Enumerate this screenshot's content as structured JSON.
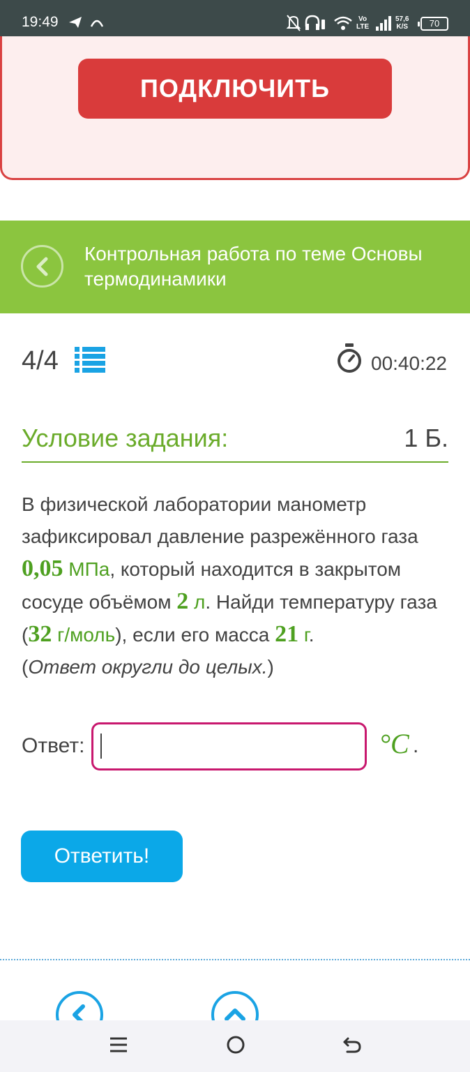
{
  "status_bar": {
    "time": "19:49",
    "network_top": "Vo",
    "network_bottom": "LTE",
    "speed_top": "57,6",
    "speed_bottom": "K/S",
    "battery": "70"
  },
  "ad": {
    "button_label": "ПОДКЛЮЧИТЬ"
  },
  "header": {
    "title": "Контрольная работа по теме Основы термодинамики"
  },
  "progress": {
    "current": "4",
    "separator": "/",
    "total": "4",
    "timer": "00:40:22"
  },
  "task": {
    "heading": "Условие задания:",
    "points": "1 Б.",
    "text_1": "В физической лаборатории манометр зафиксировал давление разрежённого газа ",
    "pressure_value": "0,05",
    "pressure_unit": " МПа",
    "text_2": ", который находится в закрытом сосуде объёмом ",
    "volume_value": "2",
    "volume_unit": " л",
    "text_3": ". Найди температуру газа (",
    "molar_value": "32",
    "molar_unit": " г/моль",
    "text_4": "), если его масса ",
    "mass_value": "21",
    "mass_unit": " г",
    "text_5": ".",
    "hint_open": "(",
    "hint": "Ответ округли до целых.",
    "hint_close": ")"
  },
  "answer": {
    "label": "Ответ:",
    "value": "",
    "unit": "°C",
    "unit_suffix": "."
  },
  "submit": {
    "label": "Ответить!"
  },
  "colors": {
    "header_green": "#8bc53f",
    "accent_green": "#6aab2a",
    "ad_red": "#d93b3b",
    "input_border": "#c8186e",
    "submit_blue": "#0ba8e8"
  }
}
